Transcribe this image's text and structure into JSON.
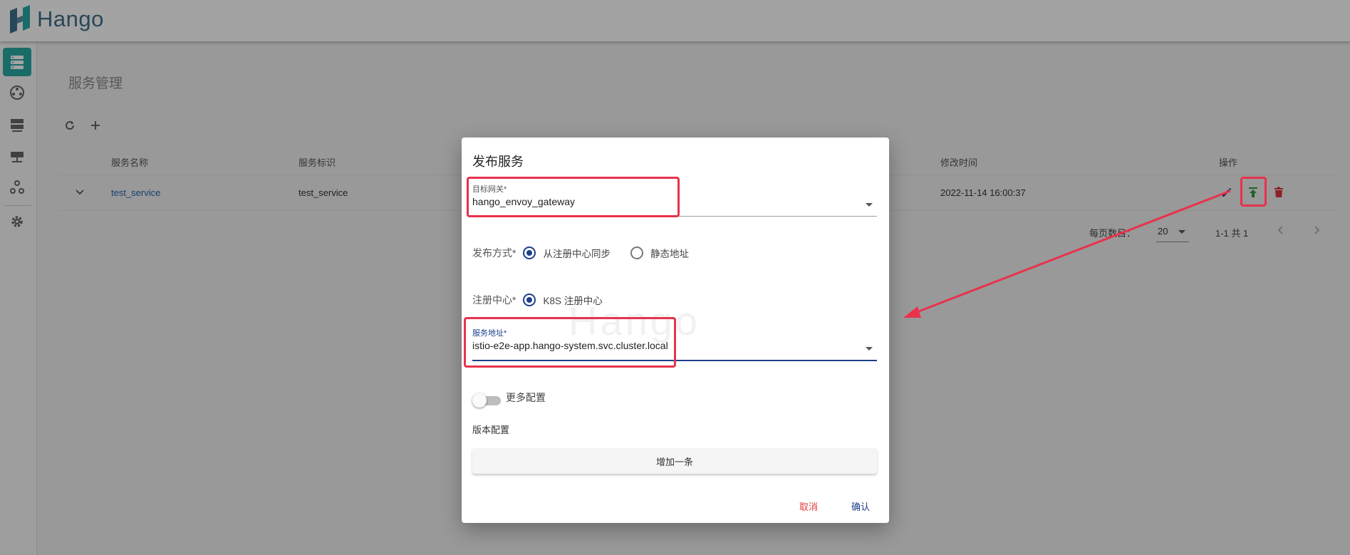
{
  "header": {
    "app_name": "Hango"
  },
  "sidebar": {
    "items": [
      {
        "icon": "service-list-icon",
        "active": true
      },
      {
        "icon": "routing-icon",
        "active": false
      },
      {
        "icon": "server-icon",
        "active": false
      },
      {
        "icon": "gateway-icon",
        "active": false
      },
      {
        "icon": "plugin-network-icon",
        "active": false
      },
      {
        "icon": "gear-icon",
        "active": false
      }
    ]
  },
  "page": {
    "title": "服务管理",
    "toolbar": {
      "refresh_icon": "refresh-icon",
      "add_icon": "plus-icon"
    }
  },
  "table": {
    "columns": [
      "服务名称",
      "服务标识",
      "修改时间",
      "操作"
    ],
    "rows": [
      {
        "name": "test_service",
        "identifier": "test_service",
        "modified": "2022-11-14 16:00:37"
      }
    ]
  },
  "pagination": {
    "per_page_label": "每页数目：",
    "per_page_value": "20",
    "range": "1-1 共 1"
  },
  "dialog": {
    "title": "发布服务",
    "gateway_field": {
      "label": "目标网关*",
      "value": "hango_envoy_gateway"
    },
    "publish_mode": {
      "label": "发布方式*",
      "options": [
        "从注册中心同步",
        "静态地址"
      ],
      "selected": "从注册中心同步"
    },
    "registry": {
      "label": "注册中心*",
      "options": [
        "K8S 注册中心"
      ],
      "selected": "K8S 注册中心"
    },
    "address_field": {
      "label": "服务地址*",
      "value": "istio-e2e-app.hango-system.svc.cluster.local"
    },
    "more_config_label": "更多配置",
    "more_config_enabled": false,
    "version_config_label": "版本配置",
    "add_button": "增加一条",
    "cancel": "取消",
    "confirm": "确认",
    "watermark": "Hango"
  },
  "colors": {
    "accent": "#1d3f8c",
    "sidebar_active": "#2aa9a4",
    "annotation": "#e8324c",
    "publish_icon": "#2e9b45",
    "delete_icon": "#d9363e",
    "cancel_text": "#e03c3c"
  }
}
